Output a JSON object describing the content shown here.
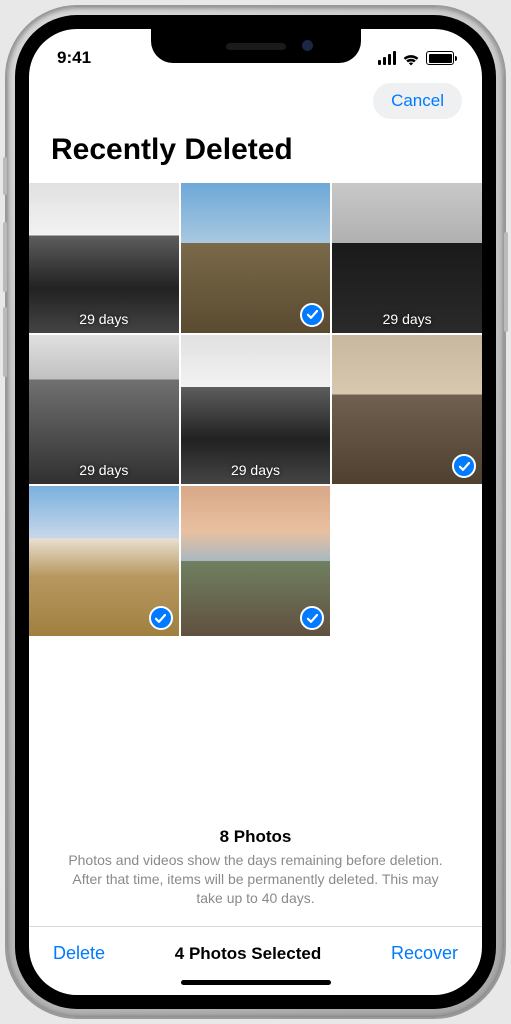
{
  "status": {
    "time": "9:41"
  },
  "nav": {
    "cancel": "Cancel"
  },
  "title": "Recently Deleted",
  "photos": [
    {
      "label": "29 days",
      "selected": false,
      "style": "bw-mtn"
    },
    {
      "label": "",
      "selected": true,
      "style": "sky-top"
    },
    {
      "label": "29 days",
      "selected": false,
      "style": "bw-trees"
    },
    {
      "label": "29 days",
      "selected": false,
      "style": "bw-ridge"
    },
    {
      "label": "29 days",
      "selected": false,
      "style": "bw-mtn"
    },
    {
      "label": "",
      "selected": true,
      "style": "sunset-plain"
    },
    {
      "label": "",
      "selected": true,
      "style": "sky-peak"
    },
    {
      "label": "",
      "selected": true,
      "style": "sunset-field"
    }
  ],
  "summary": {
    "count": "8 Photos",
    "note": "Photos and videos show the days remaining before deletion. After that time, items will be permanently deleted. This may take up to 40 days."
  },
  "toolbar": {
    "delete": "Delete",
    "status": "4 Photos Selected",
    "recover": "Recover"
  }
}
